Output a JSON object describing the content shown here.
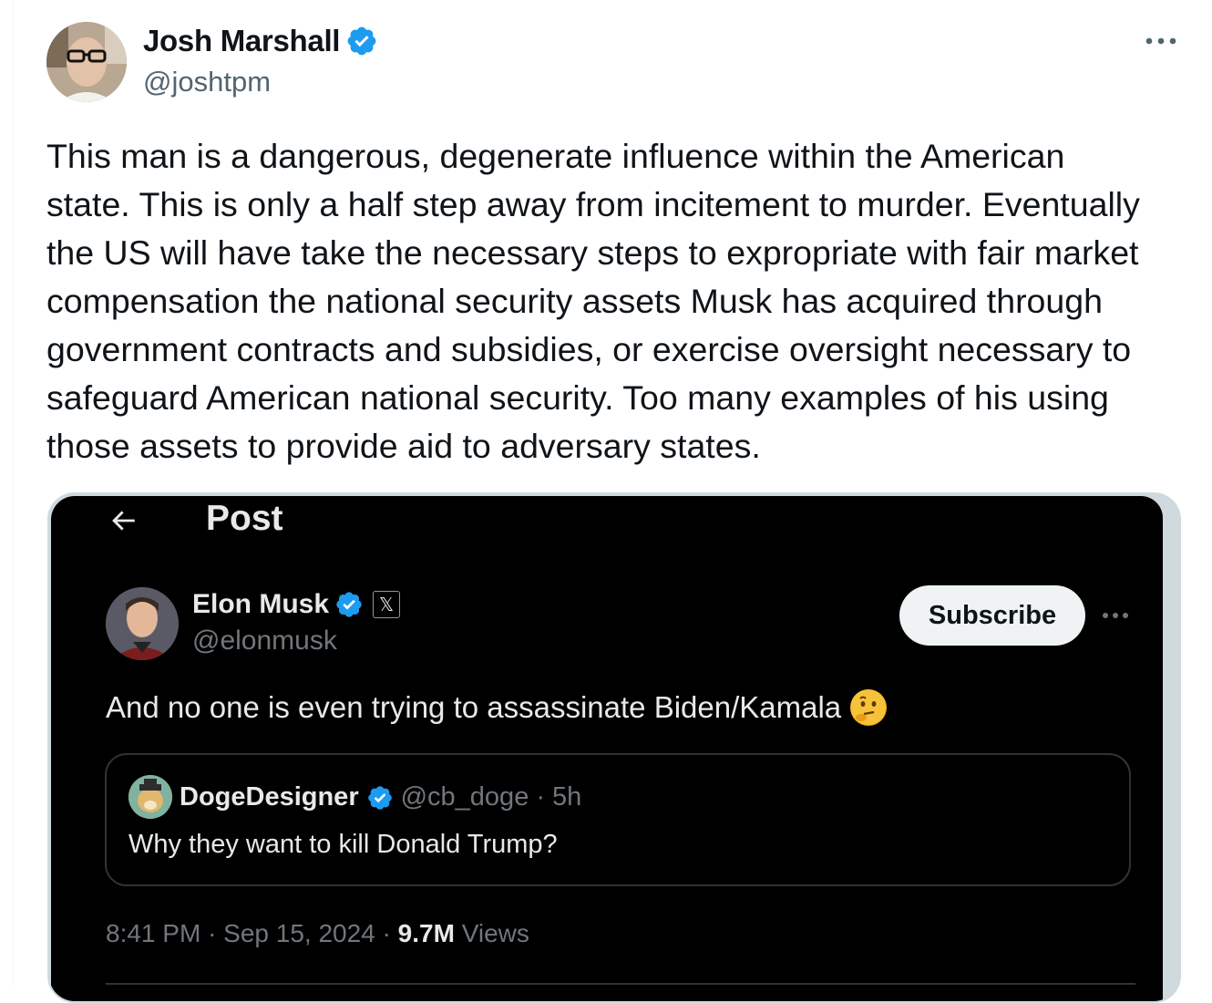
{
  "tweet": {
    "author_name": "Josh Marshall",
    "author_handle": "@joshtpm",
    "text_lines": [
      "This man is a dangerous, degenerate influence within the American",
      "state. This is only a half step away from incitement to murder. Eventually",
      "the US will have take the necessary steps to expropriate with fair market",
      "compensation the national security assets Musk has acquired through",
      "government contracts and subsidies, or exercise oversight necessary to",
      "safeguard American national security. Too many examples of his using",
      "those assets to provide aid to adversary states."
    ],
    "verified_icon": "verified-badge-icon",
    "more_icon": "more-options-icon"
  },
  "embedded": {
    "header_title": "Post",
    "back_icon": "back-arrow-icon",
    "author_name": "Elon Musk",
    "author_handle": "@elonmusk",
    "affiliation_badge": "𝕏",
    "subscribe_label": "Subscribe",
    "text": "And no one is even trying to assassinate Biden/Kamala",
    "emoji": "🤔",
    "quote": {
      "author_name": "DogeDesigner",
      "author_handle": "@cb_doge",
      "separator": "·",
      "time": "5h",
      "text": "Why they want to kill Donald Trump?"
    },
    "meta": {
      "time": "8:41 PM",
      "sep1": "·",
      "date": "Sep 15, 2024",
      "sep2": "·",
      "views_count": "9.7M",
      "views_label": "Views"
    }
  },
  "colors": {
    "verified_blue": "#1d9bf0",
    "text_primary": "#0f1419",
    "text_secondary": "#536471",
    "dark_bg": "#000000"
  }
}
